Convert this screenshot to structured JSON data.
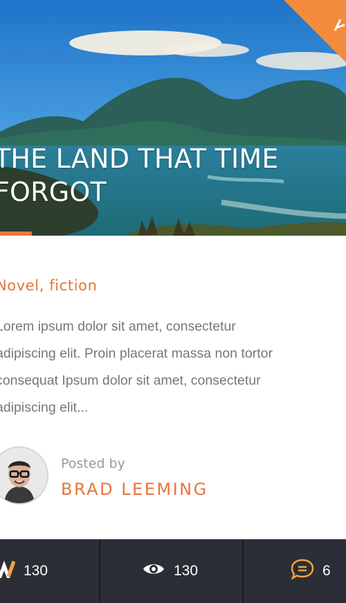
{
  "post": {
    "title_line1": "THE LAND THAT TIME",
    "title_line2": "FORGOT",
    "tags": "Novel, fiction",
    "excerpt_lines": [
      "Lorem ipsum dolor sit amet, consectetur",
      "adipiscing elit. Proin placerat massa non tortor",
      "consequat Ipsum dolor sit amet, consectetur",
      "adipiscing elit..."
    ],
    "accent_color": "#f0763a"
  },
  "author": {
    "posted_by_label": "Posted by",
    "name": "BRAD LEEMING"
  },
  "stats": {
    "likes": "130",
    "views": "130",
    "comments": "6",
    "icons": [
      "logo-w-icon",
      "eye-icon",
      "comment-bubble-icon"
    ],
    "bar_color": "#2b2e36"
  }
}
